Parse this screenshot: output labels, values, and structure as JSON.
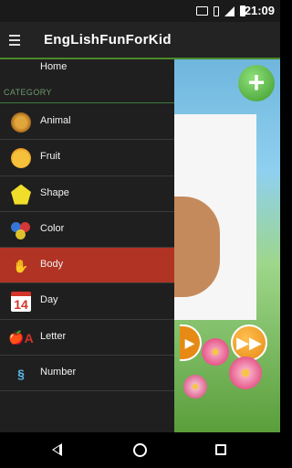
{
  "status_bar": {
    "time": "21:09",
    "icons": [
      "cast-icon",
      "vibrate-icon",
      "signal-icon",
      "battery-icon"
    ]
  },
  "app_bar": {
    "title": "EngLishFunForKid",
    "menu_icon": "hamburger-icon"
  },
  "drawer": {
    "home_label": "Home",
    "category_header": "CATEGORY",
    "items": [
      {
        "label": "Animal",
        "icon": "lion-icon",
        "active": false
      },
      {
        "label": "Fruit",
        "icon": "orange-icon",
        "active": false
      },
      {
        "label": "Shape",
        "icon": "pentagon-icon",
        "active": false
      },
      {
        "label": "Color",
        "icon": "color-circles-icon",
        "active": false
      },
      {
        "label": "Body",
        "icon": "hand-icon",
        "active": true
      },
      {
        "label": "Day",
        "icon": "calendar-icon",
        "active": false
      },
      {
        "label": "Letter",
        "icon": "apple-letter-icon",
        "active": false
      },
      {
        "label": "Number",
        "icon": "number-icon",
        "active": false
      }
    ],
    "day_icon_text": "14",
    "letter_icon_text": "A",
    "active_color": "#b13324",
    "accent_color": "#4a8a2a"
  },
  "background_content": {
    "plus_symbol": "+",
    "next_symbol": "▶▶",
    "prev_symbol": "▶"
  },
  "nav_bar": {
    "buttons": [
      "back-icon",
      "home-icon",
      "recent-apps-icon"
    ]
  }
}
